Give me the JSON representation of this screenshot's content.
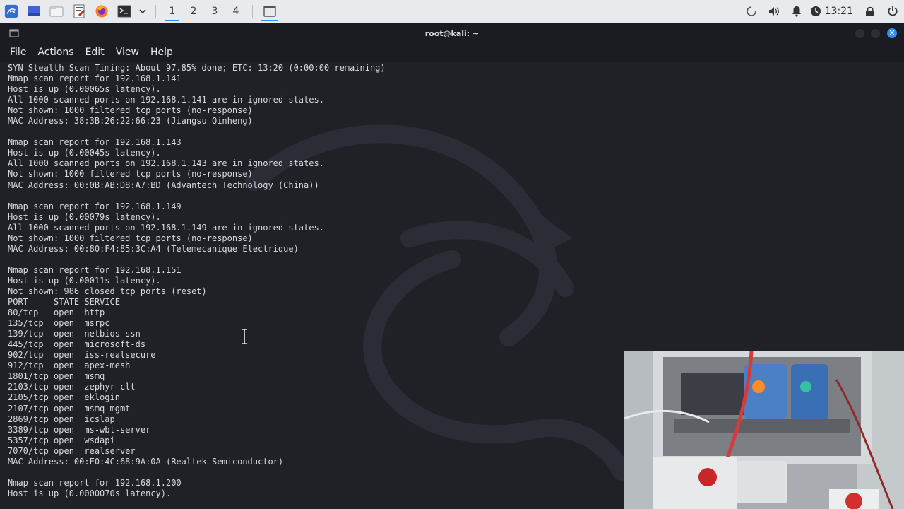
{
  "taskbar": {
    "workspaces": [
      "1",
      "2",
      "3",
      "4"
    ],
    "clock": "13:21"
  },
  "window": {
    "title": "root@kali: ~"
  },
  "menu": [
    "File",
    "Actions",
    "Edit",
    "View",
    "Help"
  ],
  "terminal": {
    "lines": [
      "SYN Stealth Scan Timing: About 97.85% done; ETC: 13:20 (0:00:00 remaining)",
      "Nmap scan report for 192.168.1.141",
      "Host is up (0.00065s latency).",
      "All 1000 scanned ports on 192.168.1.141 are in ignored states.",
      "Not shown: 1000 filtered tcp ports (no-response)",
      "MAC Address: 38:3B:26:22:66:23 (Jiangsu Qinheng)",
      "",
      "Nmap scan report for 192.168.1.143",
      "Host is up (0.00045s latency).",
      "All 1000 scanned ports on 192.168.1.143 are in ignored states.",
      "Not shown: 1000 filtered tcp ports (no-response)",
      "MAC Address: 00:0B:AB:D8:A7:BD (Advantech Technology (China))",
      "",
      "Nmap scan report for 192.168.1.149",
      "Host is up (0.00079s latency).",
      "All 1000 scanned ports on 192.168.1.149 are in ignored states.",
      "Not shown: 1000 filtered tcp ports (no-response)",
      "MAC Address: 00:80:F4:85:3C:A4 (Telemecanique Electrique)",
      "",
      "Nmap scan report for 192.168.1.151",
      "Host is up (0.00011s latency).",
      "Not shown: 986 closed tcp ports (reset)",
      "PORT     STATE SERVICE",
      "80/tcp   open  http",
      "135/tcp  open  msrpc",
      "139/tcp  open  netbios-ssn",
      "445/tcp  open  microsoft-ds",
      "902/tcp  open  iss-realsecure",
      "912/tcp  open  apex-mesh",
      "1801/tcp open  msmq",
      "2103/tcp open  zephyr-clt",
      "2105/tcp open  eklogin",
      "2107/tcp open  msmq-mgmt",
      "2869/tcp open  icslap",
      "3389/tcp open  ms-wbt-server",
      "5357/tcp open  wsdapi",
      "7070/tcp open  realserver",
      "MAC Address: 00:E0:4C:68:9A:0A (Realtek Semiconductor)",
      "",
      "Nmap scan report for 192.168.1.200",
      "Host is up (0.0000070s latency)."
    ]
  },
  "icons": {
    "launcher": "kali-menu-icon",
    "show_desktop": "desktop-icon",
    "files": "folder-icon",
    "editor": "text-editor-icon",
    "browser": "firefox-icon",
    "terminal": "terminal-icon",
    "dropdown": "chevron-down-icon",
    "tray": [
      "loading-icon",
      "volume-icon",
      "bell-icon",
      "clock-icon",
      "lock-icon",
      "power-icon"
    ]
  },
  "colors": {
    "accent": "#2f8cf3",
    "terminal_bg": "#1f2127",
    "terminal_fg": "#d7dae0",
    "taskbar_bg": "#e9eaed"
  }
}
